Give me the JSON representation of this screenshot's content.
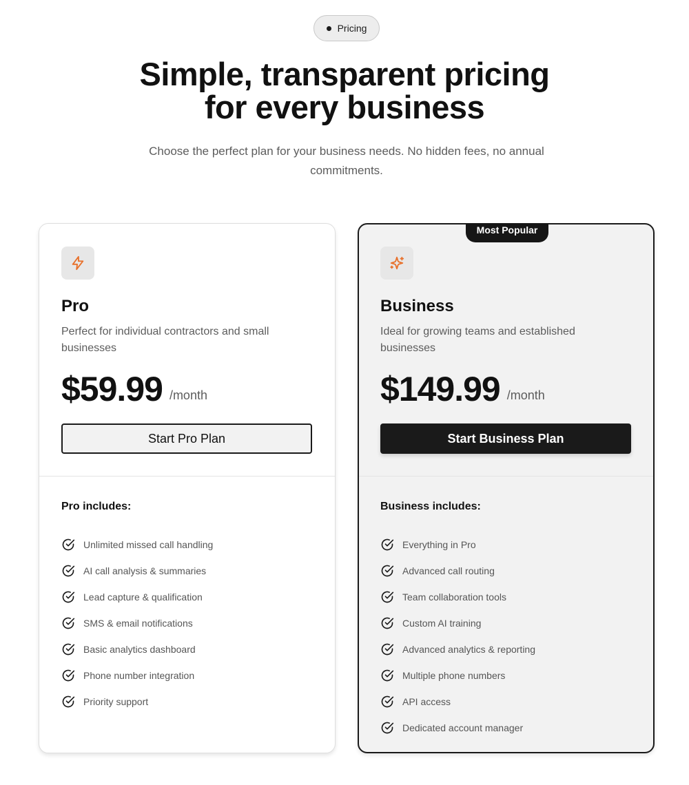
{
  "header": {
    "badge_label": "Pricing",
    "title_line1": "Simple, transparent pricing",
    "title_line2": "for every business",
    "subtitle_line1": "Choose the perfect plan for your business needs. No hidden fees, no annual",
    "subtitle_line2": "commitments."
  },
  "plans": [
    {
      "icon": "lightning-bolt-icon",
      "name": "Pro",
      "description_line1": "Perfect for individual contractors and small",
      "description_line2": "businesses",
      "price": "$59.99",
      "period": "/month",
      "cta_label": "Start Pro Plan",
      "includes_title": "Pro includes:",
      "features": [
        "Unlimited missed call handling",
        "AI call analysis & summaries",
        "Lead capture & qualification",
        "SMS & email notifications",
        "Basic analytics dashboard",
        "Phone number integration",
        "Priority support"
      ]
    },
    {
      "badge": "Most Popular",
      "icon": "sparkles-icon",
      "name": "Business",
      "description_line1": "Ideal for growing teams and established",
      "description_line2": "businesses",
      "price": "$149.99",
      "period": "/month",
      "cta_label": "Start Business Plan",
      "includes_title": "Business includes:",
      "features": [
        "Everything in Pro",
        "Advanced call routing",
        "Team collaboration tools",
        "Custom AI training",
        "Advanced analytics & reporting",
        "Multiple phone numbers",
        "API access",
        "Dedicated account manager"
      ]
    }
  ],
  "colors": {
    "accent_icon": "#e8702a",
    "primary_dark": "#1a1a1a",
    "muted_text": "#5c5c5c"
  }
}
